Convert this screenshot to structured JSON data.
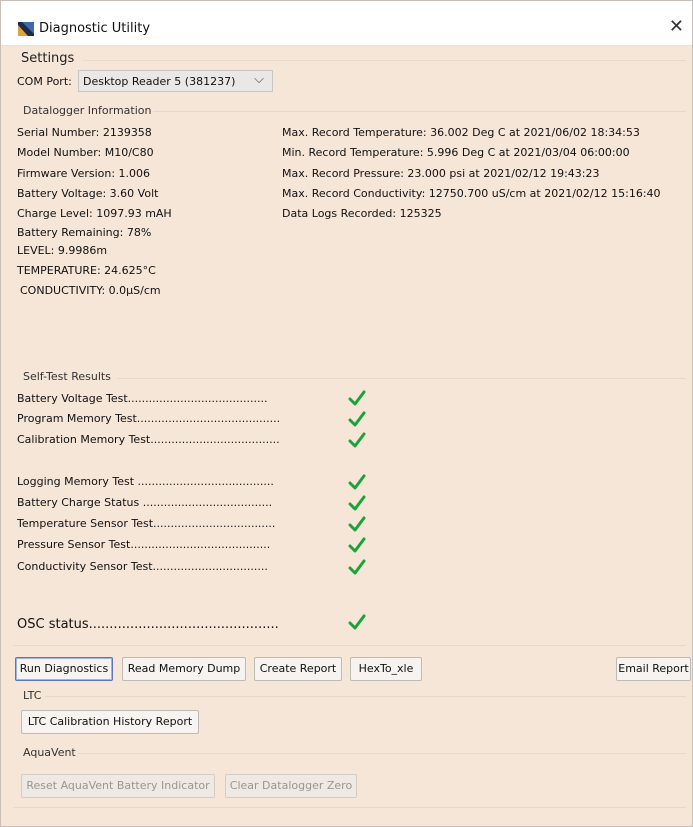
{
  "window": {
    "title": "Diagnostic Utility",
    "close_glyph": "✕"
  },
  "settings": {
    "heading": "Settings",
    "com_port_label": "COM Port:",
    "com_port_value": "Desktop Reader 5 (381237)"
  },
  "datalogger": {
    "heading": "Datalogger Information",
    "left": [
      "Serial Number: 2139358",
      "Model Number: M10/C80",
      "Firmware Version: 1.006",
      "Battery Voltage: 3.60 Volt",
      "Charge Level: 1097.93 mAH",
      "Battery Remaining: 78%",
      "LEVEL: 9.9986m",
      "TEMPERATURE: 24.625°C",
      "CONDUCTIVITY: 0.0µS/cm"
    ],
    "right": [
      "Max. Record Temperature: 36.002 Deg C at 2021/06/02 18:34:53",
      "Min. Record Temperature: 5.996 Deg C at 2021/03/04 06:00:00",
      "Max. Record Pressure: 23.000 psi at  2021/02/12 19:43:23",
      "Max. Record Conductivity: 12750.700 uS/cm at  2021/02/12 15:16:40",
      "Data Logs Recorded:  125325"
    ]
  },
  "selftest": {
    "heading": "Self-Test Results",
    "tests": [
      {
        "label": "Battery Voltage Test........................................",
        "status": "pass"
      },
      {
        "label": "Program Memory Test.........................................",
        "status": "pass"
      },
      {
        "label": "Calibration Memory Test.....................................",
        "status": "pass"
      },
      {
        "label": "Logging Memory Test .......................................",
        "status": "pass"
      },
      {
        "label": "Battery Charge Status .....................................",
        "status": "pass"
      },
      {
        "label": "Temperature Sensor Test...................................",
        "status": "pass"
      },
      {
        "label": "Pressure Sensor Test........................................",
        "status": "pass"
      },
      {
        "label": "Conductivity Sensor Test.................................",
        "status": "pass"
      }
    ],
    "osc_label": "OSC status..............................................",
    "osc_status": "pass"
  },
  "buttons": {
    "run": "Run Diagnostics",
    "dump": "Read Memory Dump",
    "report": "Create Report",
    "hexto": "HexTo_xle",
    "email": "Email Report"
  },
  "ltc": {
    "heading": "LTC",
    "history": "LTC Calibration History Report"
  },
  "aquavent": {
    "heading": "AquaVent",
    "reset": "Reset AquaVent Battery Indicator",
    "clear": "Clear Datalogger Zero"
  },
  "colors": {
    "panel_bg": "#f5e6d8",
    "check_green": "#1aa33a",
    "focus_border": "#5a78b8"
  }
}
